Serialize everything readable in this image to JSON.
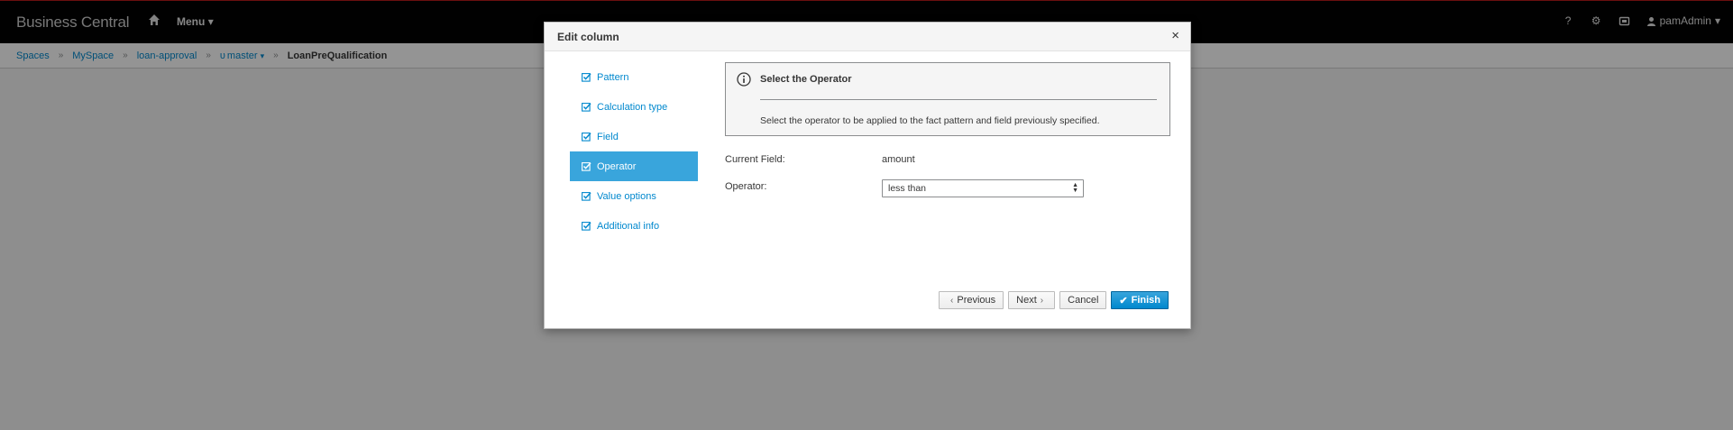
{
  "navbar": {
    "brand": "Business Central",
    "menu_label": "Menu",
    "help_label": "?",
    "user_label": "pamAdmin"
  },
  "breadcrumb": {
    "items": [
      "Spaces",
      "MySpace",
      "loan-approval",
      "master"
    ],
    "current": "LoanPreQualification"
  },
  "modal": {
    "title": "Edit column",
    "close_label": "×",
    "steps": [
      {
        "label": "Pattern",
        "active": false
      },
      {
        "label": "Calculation type",
        "active": false
      },
      {
        "label": "Field",
        "active": false
      },
      {
        "label": "Operator",
        "active": true
      },
      {
        "label": "Value options",
        "active": false
      },
      {
        "label": "Additional info",
        "active": false
      }
    ],
    "info": {
      "title": "Select the Operator",
      "text": "Select the operator to be applied to the fact pattern and field previously specified."
    },
    "current_field": {
      "label": "Current Field:",
      "value": "amount"
    },
    "operator": {
      "label": "Operator:",
      "selected": "less than"
    },
    "buttons": {
      "previous": "Previous",
      "next": "Next",
      "cancel": "Cancel",
      "finish": "Finish"
    }
  },
  "colors": {
    "accent": "#39a5dc",
    "primary": "#0088ce",
    "navbar": "#030303"
  }
}
